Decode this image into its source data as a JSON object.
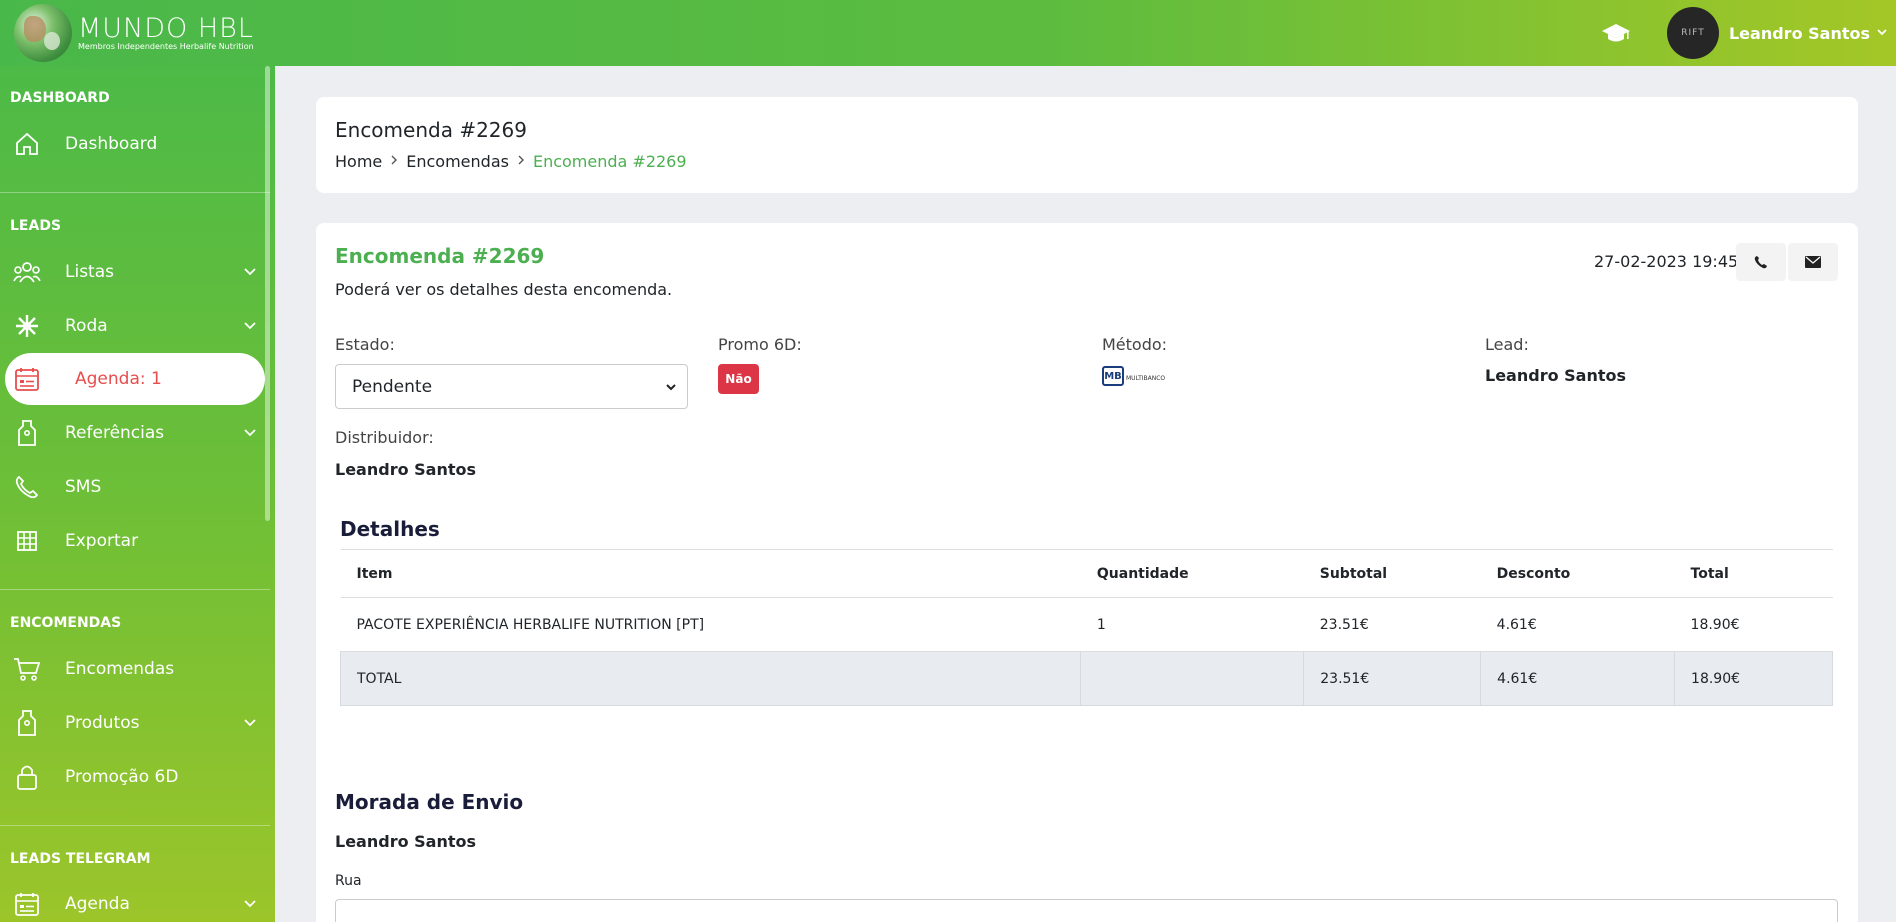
{
  "header": {
    "logo_title": "MUNDO HBL",
    "logo_subtitle": "Membros Independentes Herbalife Nutrition",
    "avatar_text": "RIFT",
    "user_name": "Leandro Santos"
  },
  "sidebar": {
    "sections": [
      {
        "title": "DASHBOARD"
      },
      {
        "title": "LEADS"
      },
      {
        "title": "ENCOMENDAS"
      },
      {
        "title": "LEADS TELEGRAM"
      }
    ],
    "items": [
      {
        "label": "Dashboard",
        "icon": "home-icon"
      },
      {
        "label": "Listas",
        "icon": "users-icon"
      },
      {
        "label": "Roda",
        "icon": "wheel-icon"
      },
      {
        "label": "Agenda: 1",
        "icon": "calendar-icon"
      },
      {
        "label": "Referências",
        "icon": "tag-icon"
      },
      {
        "label": "SMS",
        "icon": "phone-icon"
      },
      {
        "label": "Exportar",
        "icon": "table-icon"
      },
      {
        "label": "Encomendas",
        "icon": "cart-icon"
      },
      {
        "label": "Produtos",
        "icon": "tag-icon"
      },
      {
        "label": "Promoção 6D",
        "icon": "lock-icon"
      },
      {
        "label": "Agenda",
        "icon": "calendar-icon"
      }
    ]
  },
  "page_header": {
    "title": "Encomenda #2269",
    "breadcrumb": [
      "Home",
      "Encomendas",
      "Encomenda #2269"
    ]
  },
  "order": {
    "title": "Encomenda #2269",
    "subtitle": "Poderá ver os detalhes desta encomenda.",
    "date": "27-02-2023 19:45",
    "estado_label": "Estado:",
    "estado_value": "Pendente",
    "promo_label": "Promo 6D:",
    "promo_value": "Não",
    "metodo_label": "Método:",
    "metodo_logo_mb": "MB",
    "metodo_logo_text": "MULTIBANCO",
    "lead_label": "Lead:",
    "lead_value": "Leandro Santos",
    "distribuidor_label": "Distribuidor:",
    "distribuidor_value": "Leandro Santos"
  },
  "details": {
    "title": "Detalhes",
    "columns": [
      "Item",
      "Quantidade",
      "Subtotal",
      "Desconto",
      "Total"
    ],
    "rows": [
      [
        "PACOTE EXPERIÊNCIA HERBALIFE NUTRITION [PT]",
        "1",
        "23.51€",
        "4.61€",
        "18.90€"
      ]
    ],
    "total_row": [
      "TOTAL",
      "",
      "23.51€",
      "4.61€",
      "18.90€"
    ]
  },
  "shipping": {
    "title": "Morada de Envio",
    "name": "Leandro Santos",
    "rua_label": "Rua"
  },
  "colors": {
    "brand_green": "#4caf50",
    "badge_red": "#dc3545",
    "active_text": "#e84d4d"
  }
}
